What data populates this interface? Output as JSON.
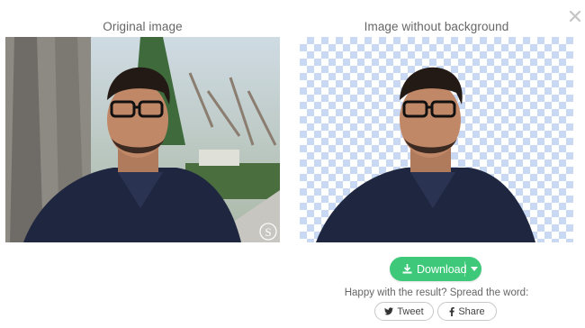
{
  "left_panel": {
    "title": "Original image",
    "watermark": "S"
  },
  "right_panel": {
    "title": "Image without background"
  },
  "actions": {
    "download_label": "Download",
    "spread_text": "Happy with the result? Spread the word:",
    "tweet_label": "Tweet",
    "share_label": "Share"
  },
  "colors": {
    "accent": "#3ec97a",
    "checker": "#c9d9f3",
    "close": "#c5c5c5"
  },
  "icons": [
    "close-icon",
    "download-icon",
    "caret-down-icon",
    "twitter-icon",
    "facebook-icon"
  ]
}
